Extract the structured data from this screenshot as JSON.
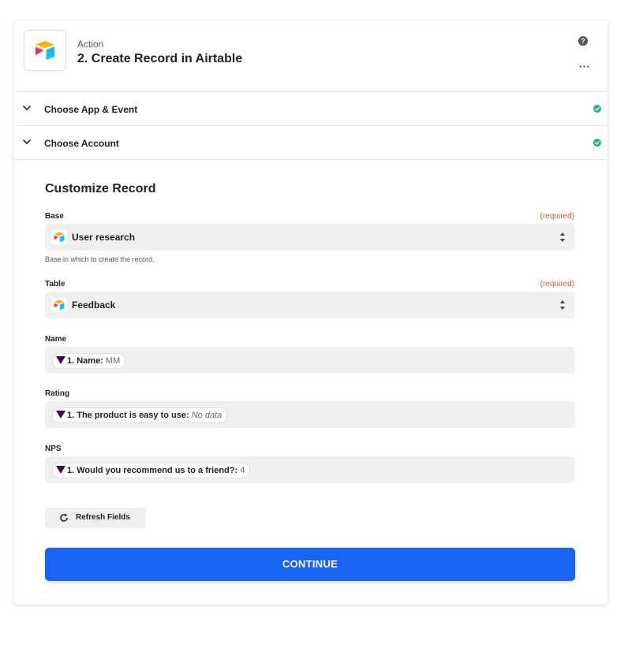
{
  "step": {
    "kind": "Action",
    "title": "2. Create Record in Airtable",
    "help_glyph": "?",
    "more_glyph": "···"
  },
  "sections": [
    {
      "label": "Choose App & Event",
      "status": "complete"
    },
    {
      "label": "Choose Account",
      "status": "complete"
    }
  ],
  "customize": {
    "heading": "Customize Record",
    "required_text": "(required)",
    "base": {
      "label": "Base",
      "value": "User research",
      "hint": "Base in which to create the record."
    },
    "table": {
      "label": "Table",
      "value": "Feedback"
    },
    "name": {
      "label": "Name",
      "token": "1. Name:",
      "value": "MM"
    },
    "rating": {
      "label": "Rating",
      "token": "1. The product is easy to use:",
      "value": "No data"
    },
    "nps": {
      "label": "NPS",
      "token": "1. Would you recommend us to a friend?:",
      "value": "4"
    }
  },
  "buttons": {
    "refresh": "Refresh Fields",
    "continue": "CONTINUE"
  },
  "colors": {
    "accent": "#1963f5",
    "required": "#e2582e",
    "success": "#1fb78b",
    "trigger_icon": "#3b0a57"
  }
}
